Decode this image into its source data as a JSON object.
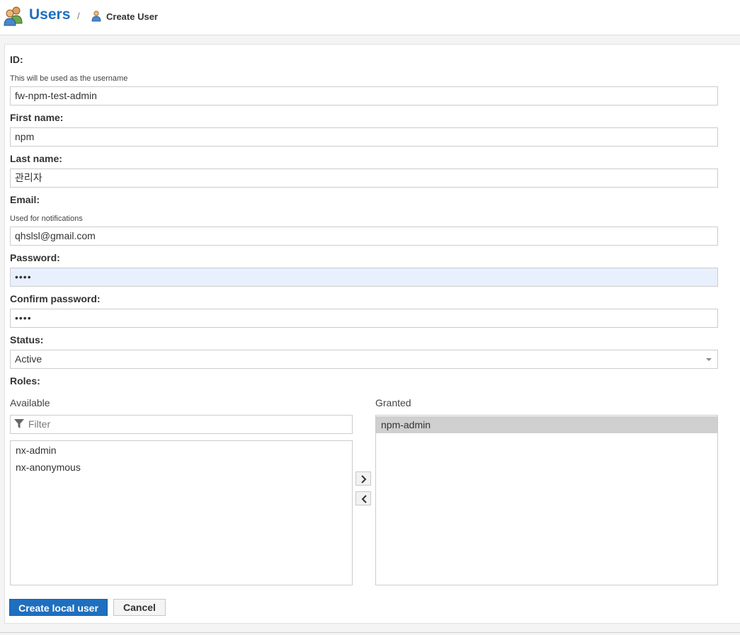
{
  "header": {
    "title": "Users",
    "separator": "/",
    "subtitle": "Create User"
  },
  "form": {
    "id_label": "ID:",
    "id_help": "This will be used as the username",
    "id_value": "fw-npm-test-admin",
    "first_name_label": "First name:",
    "first_name_value": "npm",
    "last_name_label": "Last name:",
    "last_name_value": "관리자",
    "email_label": "Email:",
    "email_help": "Used for notifications",
    "email_value": "qhslsl@gmail.com",
    "password_label": "Password:",
    "password_value": "••••",
    "confirm_password_label": "Confirm password:",
    "confirm_password_value": "••••",
    "status_label": "Status:",
    "status_value": "Active",
    "roles_label": "Roles:"
  },
  "roles": {
    "available_header": "Available",
    "filter_placeholder": "Filter",
    "available": [
      "nx-admin",
      "nx-anonymous"
    ],
    "granted_header": "Granted",
    "granted": [
      "npm-admin"
    ]
  },
  "buttons": {
    "create_label": "Create local user",
    "cancel_label": "Cancel"
  },
  "colors": {
    "accent": "#1f6fbf",
    "autofill": "#e8f0fe",
    "selected_row": "#cfcfcf"
  },
  "icons": {
    "header": "users-icon",
    "sub": "user-icon",
    "filter": "filter-icon",
    "move_right": "chevron-right-icon",
    "move_left": "chevron-left-icon",
    "select": "caret-down-icon"
  }
}
